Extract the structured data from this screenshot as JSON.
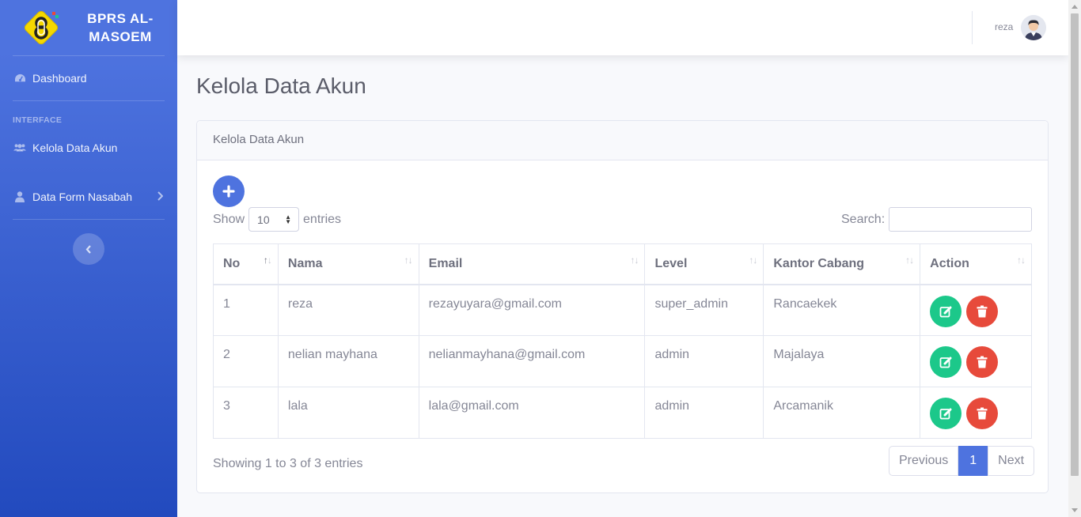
{
  "brand": {
    "line1": "BPRS AL-",
    "line2": "MASOEM"
  },
  "sidebar": {
    "items": [
      {
        "label": "Dashboard",
        "icon": "tachometer-icon"
      },
      {
        "label": "Kelola Data Akun",
        "icon": "users-icon"
      },
      {
        "label": "Data Form Nasabah",
        "icon": "user-icon"
      }
    ],
    "section_heading": "INTERFACE"
  },
  "topbar": {
    "user_name": "reza"
  },
  "page": {
    "title": "Kelola Data Akun"
  },
  "card": {
    "header": "Kelola Data Akun",
    "length": {
      "show": "Show",
      "value": "10",
      "entries": "entries"
    },
    "search_label": "Search:",
    "columns": [
      "No",
      "Nama",
      "Email",
      "Level",
      "Kantor Cabang",
      "Action"
    ],
    "rows": [
      {
        "no": "1",
        "nama": "reza",
        "email": "rezayuyara@gmail.com",
        "level": "super_admin",
        "kantor": "Rancaekek"
      },
      {
        "no": "2",
        "nama": "nelian mayhana",
        "email": "nelianmayhana@gmail.com",
        "level": "admin",
        "kantor": "Majalaya"
      },
      {
        "no": "3",
        "nama": "lala",
        "email": "lala@gmail.com",
        "level": "admin",
        "kantor": "Arcamanik"
      }
    ],
    "info": "Showing 1 to 3 of 3 entries",
    "pagination": {
      "previous": "Previous",
      "current": "1",
      "next": "Next"
    }
  },
  "colors": {
    "primary": "#4e73df",
    "success": "#1cc88a",
    "danger": "#e74a3b"
  }
}
